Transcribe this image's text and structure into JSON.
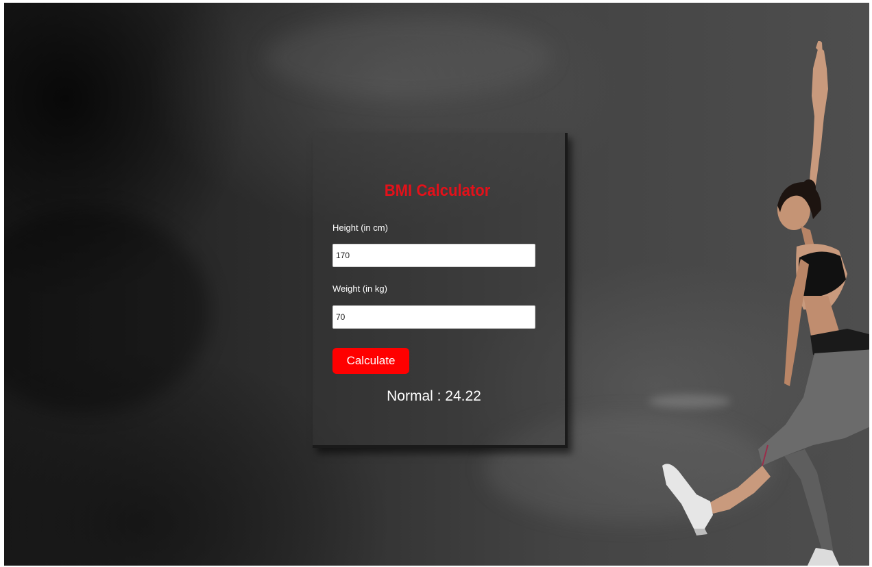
{
  "app": {
    "title": "BMI Calculator"
  },
  "form": {
    "height_label": "Height (in cm)",
    "height_value": "170",
    "weight_label": "Weight (in kg)",
    "weight_value": "70",
    "calculate_label": "Calculate",
    "result_text": "Normal : 24.22"
  },
  "colors": {
    "accent": "#e3111a",
    "button": "#ff0000",
    "background": "#3a3a3a"
  },
  "background_image": {
    "subject": "woman-jumping-athlete-photo"
  }
}
